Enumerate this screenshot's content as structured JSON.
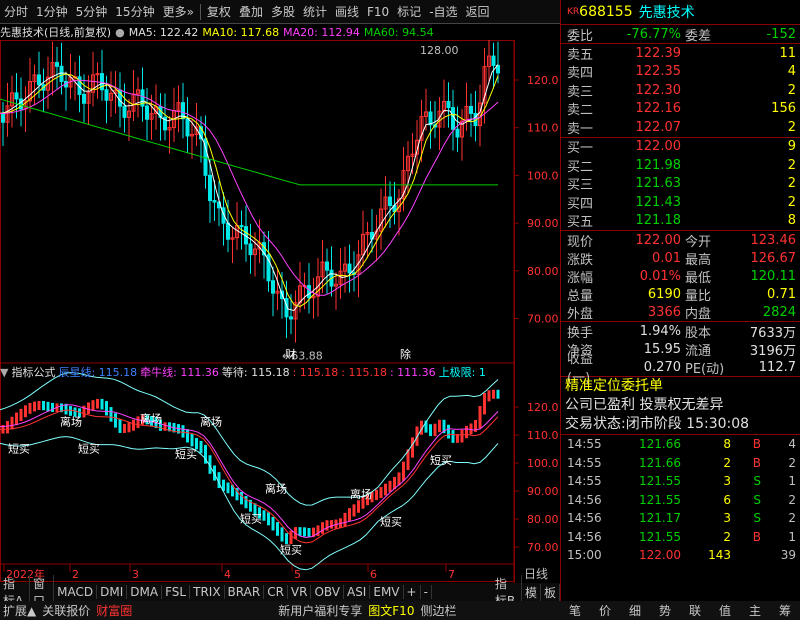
{
  "toolbar": {
    "tabs": [
      "分时",
      "1分钟",
      "5分钟",
      "15分钟",
      "更多»",
      "复权",
      "叠加",
      "多股",
      "统计",
      "画线",
      "F10",
      "标记",
      "-自选",
      "返回"
    ]
  },
  "title_row": {
    "name": "先惠技术(日线,前复权)",
    "ma5": "MA5: 122.42",
    "ma10": "MA10: 117.68",
    "ma20": "MA20: 112.94",
    "ma60": "MA60: 94.54"
  },
  "price_axis": [
    "120.0",
    "110.0",
    "100.0",
    "90.00",
    "80.00",
    "70.00"
  ],
  "price_annotations": {
    "high": "128.00",
    "low": "63.88",
    "event1": "财",
    "event2": "除"
  },
  "indicator_row": {
    "name": "指标公式",
    "l1": "辰星线: 115.18",
    "l2": "牵牛线: 111.36",
    "l3": "等待: 115.18",
    "l4": ": 115.18",
    "l5": ": 115.18",
    "l6": ": 111.36",
    "l7": "上极限: 1"
  },
  "ind_axis": [
    "120.0",
    "110.0",
    "100.0",
    "90.00",
    "80.00",
    "70.00"
  ],
  "ind_labels": {
    "leave": "离场",
    "buy": "短买"
  },
  "date_axis": [
    "2022年",
    "2",
    "3",
    "4",
    "5",
    "6",
    "7"
  ],
  "period_label": "日线",
  "bottom_tabs": [
    "指标A",
    "窗口",
    "MACD",
    "DMI",
    "DMA",
    "FSL",
    "TRIX",
    "BRAR",
    "CR",
    "VR",
    "OBV",
    "ASI",
    "EMV",
    "+",
    "-",
    "指标B",
    "模",
    "板"
  ],
  "status_tabs": [
    "扩展▲",
    "关联报价",
    "财富圈",
    "新用户福利专享",
    "图文F10",
    "侧边栏"
  ],
  "right_tabs": [
    "笔",
    "价",
    "细",
    "势",
    "联",
    "值",
    "主",
    "筹"
  ],
  "stock": {
    "market": "KR",
    "code": "688155",
    "name": "先惠技术"
  },
  "committee": {
    "wb_label": "委比",
    "wb": "-76.77%",
    "wc_label": "委差",
    "wc": "-152"
  },
  "asks": [
    {
      "label": "卖五",
      "price": "122.39",
      "vol": "11"
    },
    {
      "label": "卖四",
      "price": "122.35",
      "vol": "4"
    },
    {
      "label": "卖三",
      "price": "122.30",
      "vol": "2"
    },
    {
      "label": "卖二",
      "price": "122.16",
      "vol": "156"
    },
    {
      "label": "卖一",
      "price": "122.07",
      "vol": "2"
    }
  ],
  "bids": [
    {
      "label": "买一",
      "price": "122.00",
      "vol": "9"
    },
    {
      "label": "买二",
      "price": "121.98",
      "vol": "2"
    },
    {
      "label": "买三",
      "price": "121.63",
      "vol": "2"
    },
    {
      "label": "买四",
      "price": "121.43",
      "vol": "2"
    },
    {
      "label": "买五",
      "price": "121.18",
      "vol": "8"
    }
  ],
  "stats": [
    {
      "l1": "现价",
      "v1": "122.00",
      "l2": "今开",
      "v2": "123.46"
    },
    {
      "l1": "涨跌",
      "v1": "0.01",
      "l2": "最高",
      "v2": "126.67"
    },
    {
      "l1": "涨幅",
      "v1": "0.01%",
      "l2": "最低",
      "v2": "120.11"
    },
    {
      "l1": "总量",
      "v1": "6190",
      "l2": "量比",
      "v2": "0.71"
    },
    {
      "l1": "外盘",
      "v1": "3366",
      "l2": "内盘",
      "v2": "2824"
    }
  ],
  "stats2": [
    {
      "l1": "换手",
      "v1": "1.94%",
      "l2": "股本",
      "v2": "7633万"
    },
    {
      "l1": "净资",
      "v1": "15.95",
      "l2": "流通",
      "v2": "3196万"
    },
    {
      "l1": "收益(一)",
      "v1": "0.270",
      "l2": "PE(动)",
      "v2": "112.7"
    }
  ],
  "info": {
    "line1": "精准定位委托单",
    "line2": "公司已盈利 投票权无差异",
    "line3_label": "交易状态:",
    "line3_status": "闭市阶段",
    "line3_time": "15:30:08"
  },
  "ticks": [
    {
      "t": "14:55",
      "p": "121.66",
      "v": "8",
      "bs": "B",
      "n": "4"
    },
    {
      "t": "14:55",
      "p": "121.66",
      "v": "2",
      "bs": "B",
      "n": "2"
    },
    {
      "t": "14:55",
      "p": "121.55",
      "v": "3",
      "bs": "S",
      "n": "1"
    },
    {
      "t": "14:56",
      "p": "121.55",
      "v": "6",
      "bs": "S",
      "n": "2"
    },
    {
      "t": "14:56",
      "p": "121.17",
      "v": "3",
      "bs": "S",
      "n": "2"
    },
    {
      "t": "14:56",
      "p": "121.55",
      "v": "2",
      "bs": "B",
      "n": "1"
    },
    {
      "t": "15:00",
      "p": "122.00",
      "v": "143",
      "bs": "",
      "n": "39"
    }
  ]
}
